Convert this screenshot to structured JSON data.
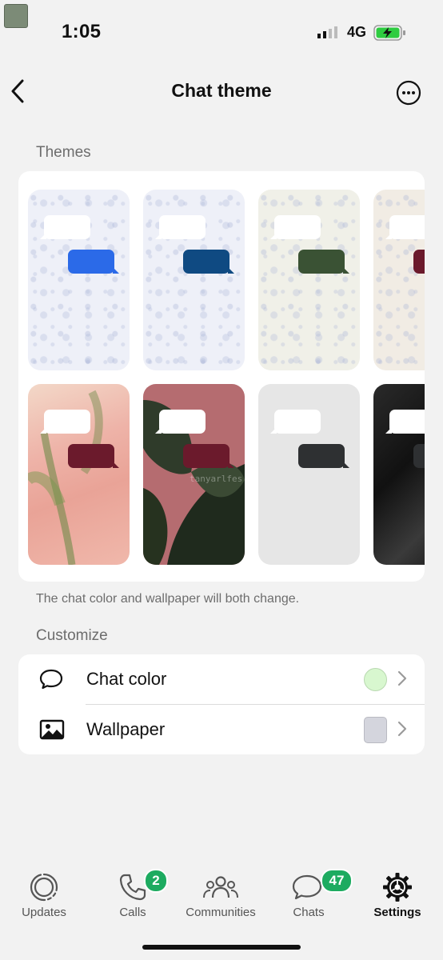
{
  "status_bar": {
    "time": "1:05",
    "network": "4G"
  },
  "header": {
    "title": "Chat theme"
  },
  "themes_section": {
    "label": "Themes",
    "caption": "The chat color and wallpaper will both change.",
    "tiles": [
      {
        "bubble_color": "#2b6ae8",
        "bg": "pattern-blue"
      },
      {
        "bubble_color": "#0f4a82",
        "bg": "pattern-blue"
      },
      {
        "bubble_color": "#3a5234",
        "bg": "pattern-green"
      },
      {
        "bubble_color": "#6b1a2c",
        "bg": "pattern-beige"
      },
      {
        "bubble_color": "#6b1a2c",
        "bg": "photo-pink"
      },
      {
        "bubble_color": "#6b1a2c",
        "bg": "photo-plant"
      },
      {
        "bubble_color": "#2e3032",
        "bg": "plain-gray"
      },
      {
        "bubble_color": "#2e3032",
        "bg": "photo-dark"
      }
    ],
    "watermark": "tanyarlfes"
  },
  "customize_section": {
    "label": "Customize",
    "rows": [
      {
        "label": "Chat color",
        "icon": "speech-bubble-icon",
        "swatch": "#d8f7cf"
      },
      {
        "label": "Wallpaper",
        "icon": "image-icon",
        "swatch": "#d4d5dd"
      }
    ]
  },
  "tab_bar": {
    "tabs": [
      {
        "label": "Updates",
        "icon": "updates-icon",
        "badge": null
      },
      {
        "label": "Calls",
        "icon": "phone-icon",
        "badge": "2"
      },
      {
        "label": "Communities",
        "icon": "communities-icon",
        "badge": null
      },
      {
        "label": "Chats",
        "icon": "chats-icon",
        "badge": "47"
      },
      {
        "label": "Settings",
        "icon": "settings-gear-icon",
        "badge": null,
        "active": true
      }
    ]
  },
  "colors": {
    "accent_green": "#1dab60",
    "background": "#f2f2f2",
    "card": "#ffffff"
  }
}
